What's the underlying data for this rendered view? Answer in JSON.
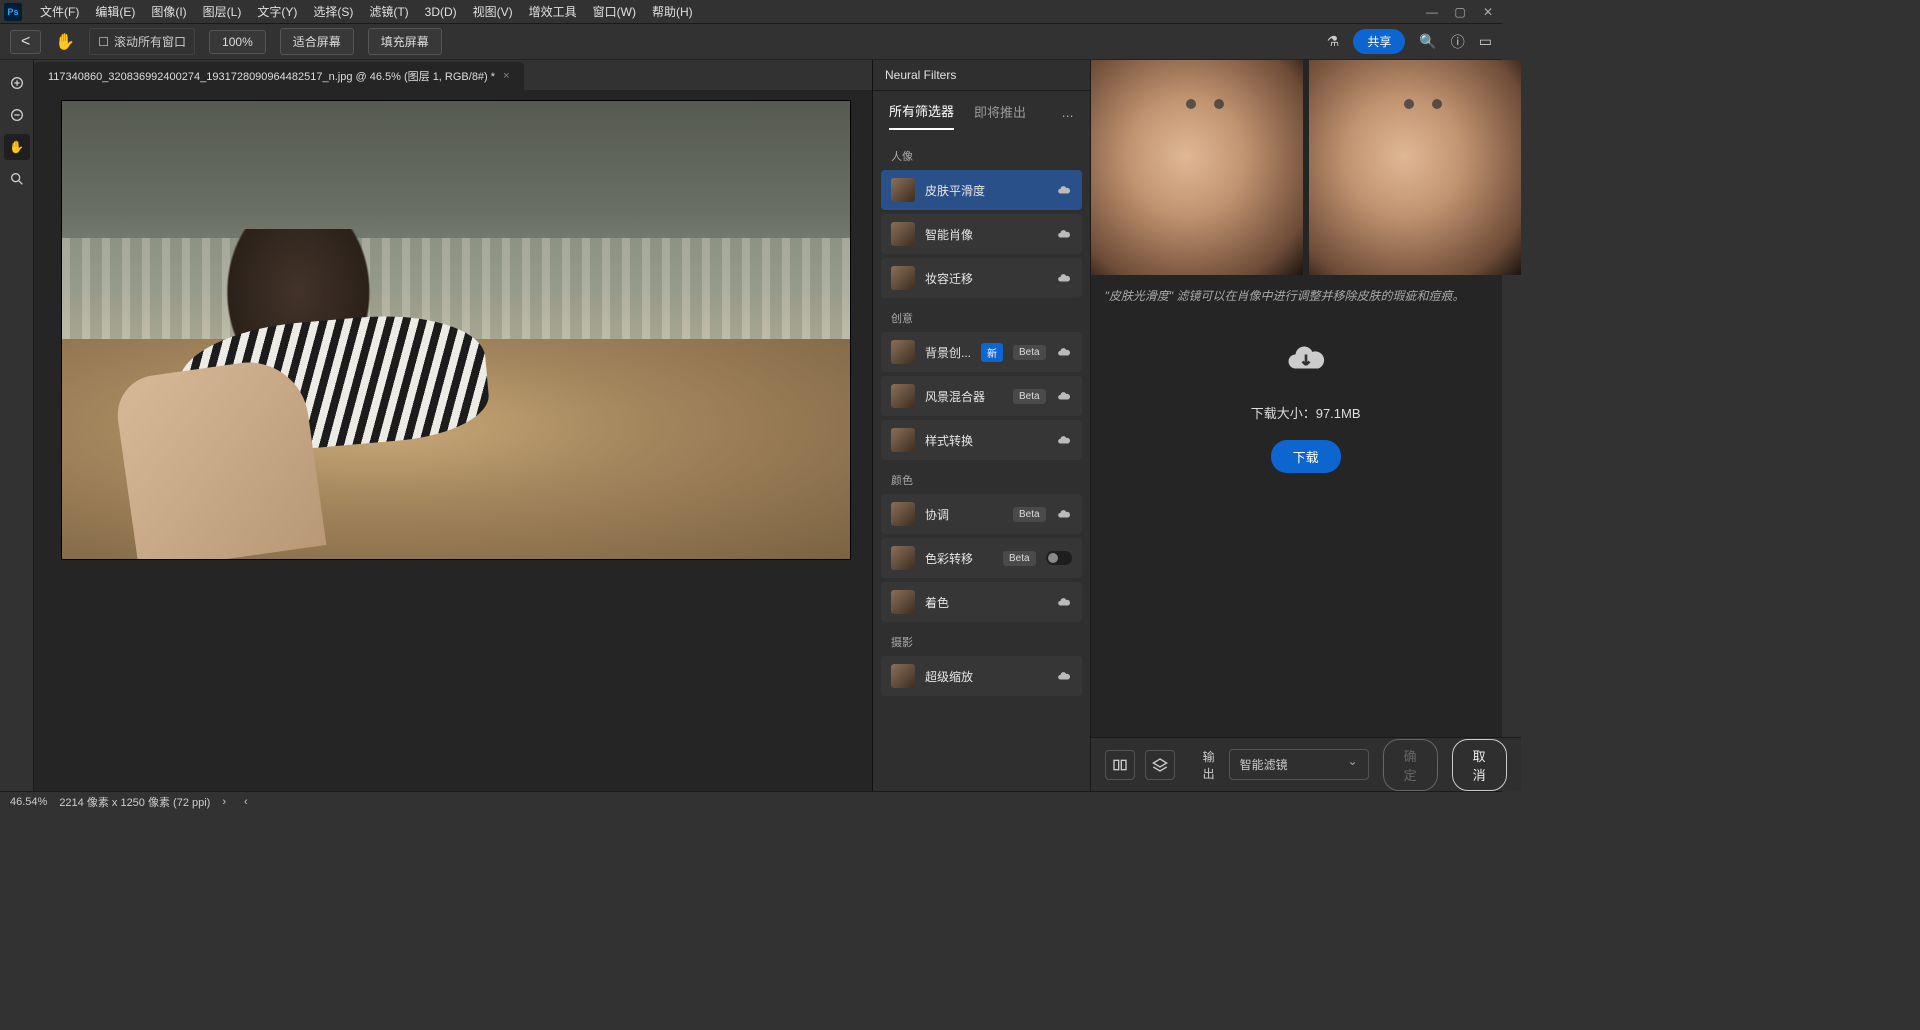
{
  "menubar": {
    "items": [
      "文件(F)",
      "编辑(E)",
      "图像(I)",
      "图层(L)",
      "文字(Y)",
      "选择(S)",
      "滤镜(T)",
      "3D(D)",
      "视图(V)",
      "增效工具",
      "窗口(W)",
      "帮助(H)"
    ]
  },
  "optionsbar": {
    "scroll_all_label": "滚动所有窗口",
    "zoom_value": "100%",
    "fit_screen": "适合屏幕",
    "fill_screen": "填充屏幕",
    "share": "共享"
  },
  "document": {
    "tab_title": "117340860_320836992400274_1931728090964482517_n.jpg @ 46.5% (图层 1, RGB/8#) *"
  },
  "neural_filters": {
    "panel_title": "Neural Filters",
    "tab_all": "所有筛选器",
    "tab_upcoming": "即将推出",
    "categories": [
      {
        "name": "人像",
        "items": [
          {
            "label": "皮肤平滑度",
            "selected": true,
            "cloud": true
          },
          {
            "label": "智能肖像",
            "cloud": true
          },
          {
            "label": "妆容迁移",
            "cloud": true
          }
        ]
      },
      {
        "name": "创意",
        "items": [
          {
            "label": "背景创...",
            "new_badge": "新",
            "beta": "Beta",
            "cloud": true
          },
          {
            "label": "风景混合器",
            "beta": "Beta",
            "cloud": true
          },
          {
            "label": "样式转换",
            "cloud": true
          }
        ]
      },
      {
        "name": "颜色",
        "items": [
          {
            "label": "协调",
            "beta": "Beta",
            "cloud": true
          },
          {
            "label": "色彩转移",
            "beta": "Beta",
            "toggle": true
          },
          {
            "label": "着色",
            "cloud": true
          }
        ]
      },
      {
        "name": "摄影",
        "items": [
          {
            "label": "超级缩放",
            "cloud": true
          }
        ]
      }
    ],
    "description": "\"皮肤光滑度\" 滤镜可以在肖像中进行调整并移除皮肤的瑕疵和痘痕。",
    "download_size_label": "下载大小：",
    "download_size_value": "97.1MB",
    "download_button": "下载",
    "output_label": "输出",
    "output_value": "智能滤镜",
    "ok_button": "确定",
    "cancel_button": "取消"
  },
  "statusbar": {
    "zoom": "46.54%",
    "dimensions": "2214 像素 x 1250 像素 (72 ppi)"
  }
}
